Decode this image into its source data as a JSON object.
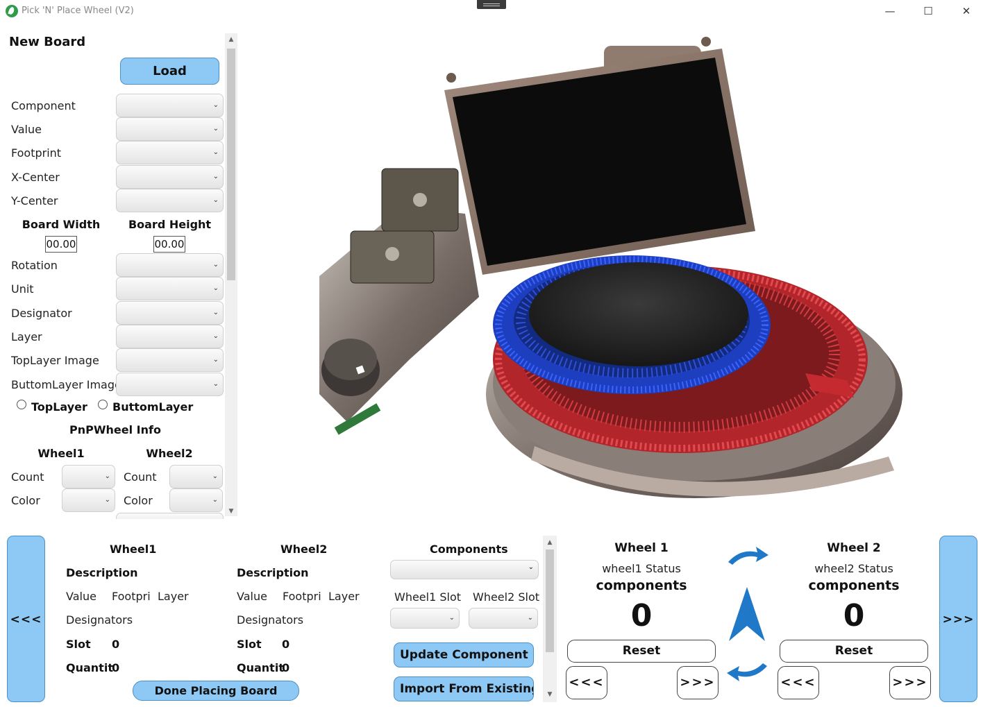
{
  "window": {
    "title": "Pick 'N' Place Wheel (V2)",
    "min_glyph": "—",
    "max_glyph": "☐",
    "close_glyph": "✕"
  },
  "left_panel": {
    "heading": "New Board",
    "load_label": "Load",
    "fields": [
      {
        "label": "Component"
      },
      {
        "label": "Value"
      },
      {
        "label": "Footprint"
      },
      {
        "label": "X-Center"
      },
      {
        "label": "Y-Center"
      }
    ],
    "board_width_label": "Board Width",
    "board_height_label": "Board Height",
    "board_width_value": "00.00",
    "board_height_value": "00.00",
    "fields2": [
      {
        "label": "Rotation"
      },
      {
        "label": "Unit"
      },
      {
        "label": "Designator"
      },
      {
        "label": "Layer"
      },
      {
        "label": "TopLayer Image"
      },
      {
        "label": "ButtomLayer Image"
      }
    ],
    "radio_top": "TopLayer",
    "radio_bottom": "ButtomLayer",
    "info_heading": "PnPWheel Info",
    "wheel1_label": "Wheel1",
    "wheel2_label": "Wheel2",
    "count_label": "Count",
    "color_label": "Color"
  },
  "bottom": {
    "prev_label": "<<<",
    "next_label": ">>>",
    "wheel1": {
      "title": "Wheel1",
      "description": "Description",
      "value": "Value",
      "footprint": "Footpri",
      "layer": "Layer",
      "designators": "Designators",
      "slot_label": "Slot",
      "slot_value": "0",
      "quantity_label": "Quantit",
      "quantity_value": "0"
    },
    "wheel2": {
      "title": "Wheel2",
      "description": "Description",
      "value": "Value",
      "footprint": "Footpri",
      "layer": "Layer",
      "designators": "Designators",
      "slot_label": "Slot",
      "slot_value": "0",
      "quantity_label": "Quantit",
      "quantity_value": "0"
    },
    "done_label": "Done Placing Board",
    "components_heading": "Components",
    "wheel1_slot_label": "Wheel1 Slot",
    "wheel2_slot_label": "Wheel2 Slot",
    "update_label": "Update Component Pc",
    "import_label": "Import From Existing Pr"
  },
  "status": {
    "wheel1": {
      "title": "Wheel 1",
      "status": "wheel1 Status",
      "components": "components",
      "count": "0",
      "reset": "Reset",
      "prev": "<<<",
      "next": ">>>"
    },
    "wheel2": {
      "title": "Wheel 2",
      "status": "wheel2 Status",
      "components": "components",
      "count": "0",
      "reset": "Reset",
      "prev": "<<<",
      "next": ">>>"
    }
  },
  "colors": {
    "accent_blue": "#8ec8f4",
    "arrow_blue": "#1f78c8"
  },
  "icons": [
    "app-leaf-icon",
    "rotate-cw-icon",
    "rotate-ccw-icon",
    "up-arrow-icon",
    "chevron-down-icon"
  ]
}
